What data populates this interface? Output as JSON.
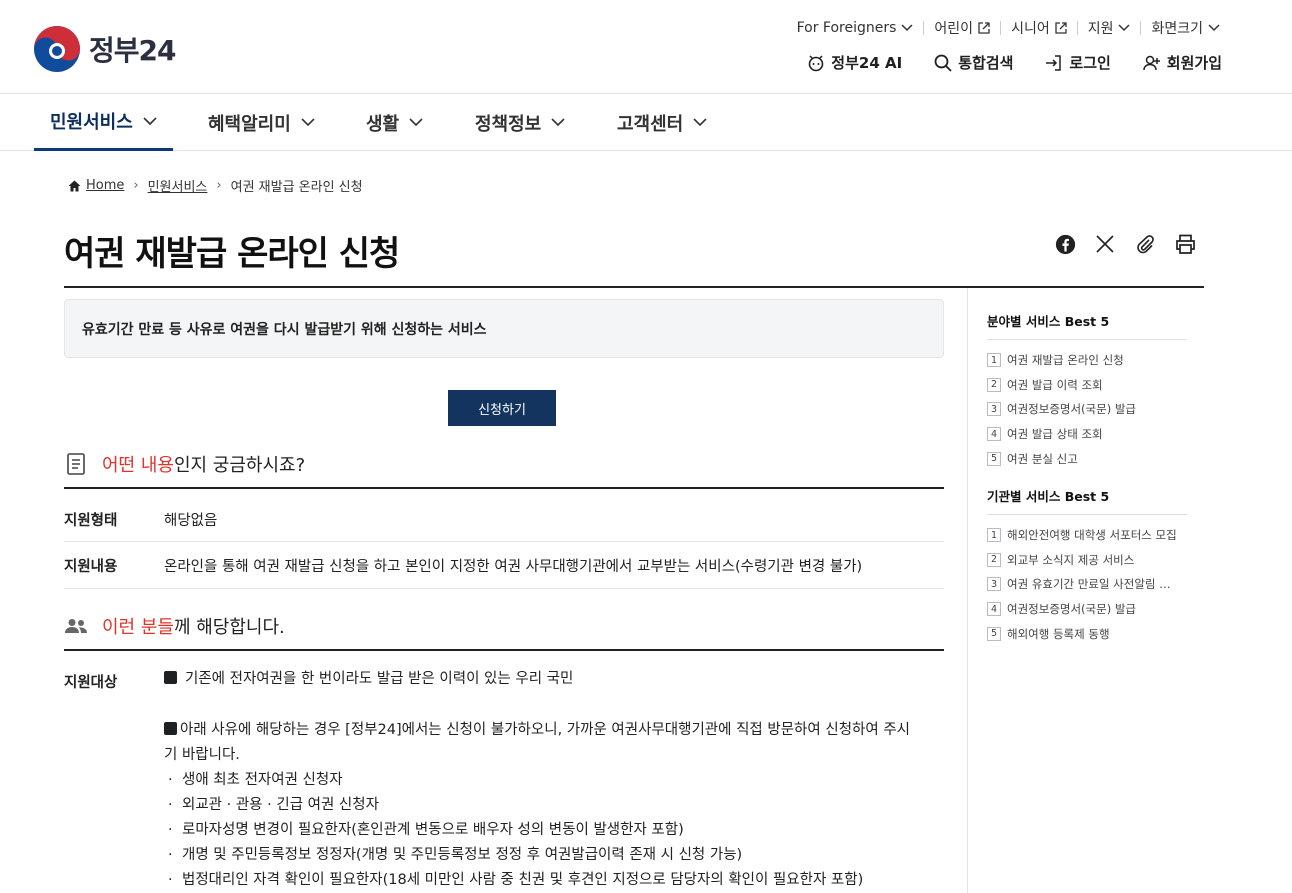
{
  "header": {
    "logo_text": "정부24",
    "utility_links": [
      {
        "label": "For Foreigners",
        "icon": "chevron-down-icon"
      },
      {
        "label": "어린이",
        "icon": "external-link-icon"
      },
      {
        "label": "시니어",
        "icon": "external-link-icon"
      },
      {
        "label": "지원",
        "icon": "chevron-down-icon"
      },
      {
        "label": "화면크기",
        "icon": "chevron-down-icon"
      }
    ],
    "actions": [
      {
        "label": "정부24 AI",
        "icon": "ai-bot-icon"
      },
      {
        "label": "통합검색",
        "icon": "search-icon"
      },
      {
        "label": "로그인",
        "icon": "login-icon"
      },
      {
        "label": "회원가입",
        "icon": "user-add-icon"
      }
    ]
  },
  "nav": {
    "items": [
      "민원서비스",
      "혜택알리미",
      "생활",
      "정책정보",
      "고객센터"
    ],
    "active_index": 0
  },
  "breadcrumb": {
    "home": "Home",
    "level1": "민원서비스",
    "current": "여권 재발급 온라인 신청"
  },
  "page": {
    "title": "여권 재발급 온라인 신청",
    "share_icons": [
      "facebook-icon",
      "x-icon",
      "link-icon",
      "print-icon"
    ],
    "summary": "유효기간 만료 등 사유로 여권을 다시 발급받기 위해 신청하는 서비스",
    "apply_button": "신청하기"
  },
  "section_what": {
    "highlight": "어떤 내용",
    "rest": "인지 궁금하시죠?",
    "rows": [
      {
        "label": "지원형태",
        "value": "해당없음"
      },
      {
        "label": "지원내용",
        "value": "온라인을 통해 여권 재발급 신청을 하고 본인이 지정한 여권 사무대행기관에서 교부받는 서비스(수령기관 변경 불가)"
      }
    ]
  },
  "section_who": {
    "highlight": "이런 분들",
    "rest": "께 해당합니다.",
    "label": "지원대상",
    "primary": "기존에 전자여권을 한 번이라도 발급 받은 이력이 있는 우리 국민",
    "notice": "아래 사유에 해당하는 경우 [정부24]에서는 신청이 불가하오니, 가까운 여권사무대행기관에 직접 방문하여 신청하여 주시기 바랍니다.",
    "items": [
      "생애 최초 전자여권 신청자",
      "외교관 · 관용 · 긴급 여권 신청자",
      "로마자성명 변경이 필요한자(혼인관계 변동으로 배우자 성의 변동이 발생한자 포함)",
      "개명 및 주민등록정보 정정자(개명 및 주민등록정보 정정 후 여권발급이력 존재 시 신청 가능)",
      "법정대리인 자격 확인이 필요한자(18세 미만인 사람 중 친권 및 후견인 지정으로 담당자의 확인이 필요한자 포함)"
    ]
  },
  "sidebar": {
    "best_by_field": {
      "title": "분야별 서비스 Best 5",
      "items": [
        "여권 재발급 온라인 신청",
        "여권 발급 이력 조회",
        "여권정보증명서(국문) 발급",
        "여권 발급 상태 조회",
        "여권 분실 신고"
      ]
    },
    "best_by_agency": {
      "title": "기관별 서비스 Best 5",
      "items": [
        "해외안전여행 대학생 서포터스 모집",
        "외교부 소식지 제공 서비스",
        "여권 유효기간 만료일 사전알림 서비스",
        "여권정보증명서(국문) 발급",
        "해외여행 등록제 동행"
      ]
    }
  },
  "colors": {
    "brand_navy": "#13345e",
    "highlight_red": "#e0332c",
    "logo_red": "#cd2e3a",
    "logo_blue": "#0f4c9c"
  }
}
